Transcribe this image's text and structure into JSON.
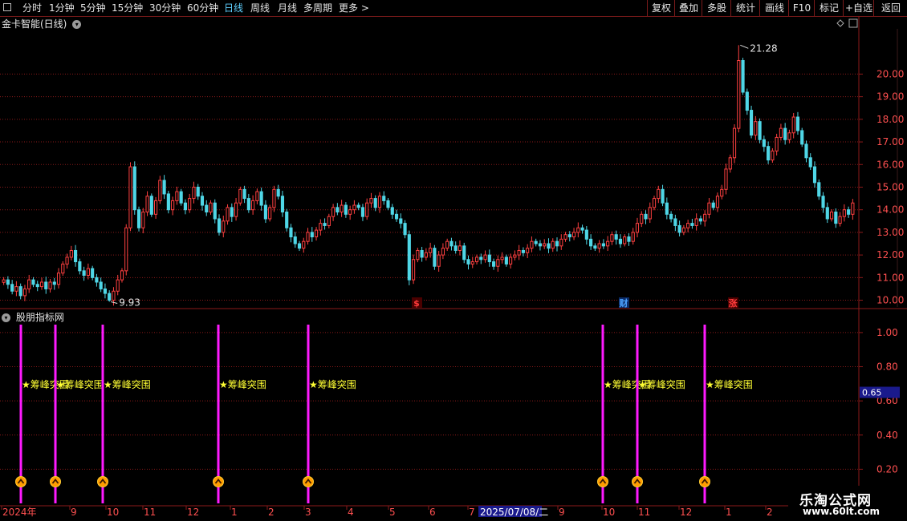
{
  "toolbar": {
    "left_items": [
      "分时",
      "1分钟",
      "5分钟",
      "15分钟",
      "30分钟",
      "60分钟",
      "日线",
      "周线",
      "月线",
      "多周期",
      "更多 >"
    ],
    "active_item": "日线",
    "right_items": [
      "复权",
      "叠加",
      "多股",
      "统计",
      "画线",
      "F10",
      "标记",
      "+自选",
      "返回"
    ]
  },
  "header": {
    "title": "金卡智能(日线)",
    "icon": "chevron-down-circle-icon"
  },
  "indicator": {
    "title": "股朋指标网",
    "current_value": "0.65",
    "signal_label": "★筹峰突围",
    "signals_x": [
      26,
      69,
      128,
      272,
      384,
      751,
      794,
      878
    ],
    "y_ticks": [
      "1.00",
      "0.80",
      "0.60",
      "0.40",
      "0.20"
    ]
  },
  "price_axis": {
    "ticks": [
      "20.00",
      "19.00",
      "18.00",
      "17.00",
      "16.00",
      "15.00",
      "14.00",
      "13.00",
      "12.00",
      "11.00",
      "10.00"
    ]
  },
  "markers": {
    "high_label": "21.28",
    "low_label": "9.93",
    "events": [
      {
        "label": "$",
        "color": "#ff3b3b"
      },
      {
        "label": "财",
        "color": "#4da3ff"
      },
      {
        "label": "涨",
        "color": "#ff3b3b"
      }
    ]
  },
  "time_axis": {
    "labels": [
      "2024年",
      "9",
      "10",
      "11",
      "12",
      "1",
      "2",
      "3",
      "4",
      "5",
      "6",
      "7",
      "2025/07/08/二",
      "9",
      "10",
      "11",
      "12",
      "1",
      "2"
    ]
  },
  "watermark": {
    "line1": "乐淘公式网",
    "line2": "www.60lt.com"
  },
  "colors": {
    "up": "#ff4040",
    "down": "#4fd6e6",
    "grid": "#8b1a1a",
    "signal": "#ff1aff",
    "label": "#ffff33",
    "accent": "#1a1a8c"
  },
  "chart_data": {
    "type": "candlestick",
    "title": "金卡智能(日线)",
    "ylim": [
      9.7,
      22.0
    ],
    "high": 21.28,
    "low": 9.93,
    "series": [
      {
        "name": "close",
        "values": [
          10.9,
          10.7,
          10.4,
          10.6,
          10.2,
          10.5,
          10.9,
          10.7,
          10.6,
          10.8,
          10.5,
          10.8,
          10.7,
          11.2,
          11.6,
          11.9,
          12.2,
          11.7,
          11.3,
          11.1,
          11.4,
          11.0,
          10.8,
          10.5,
          10.3,
          10.0,
          10.4,
          10.9,
          11.3,
          13.2,
          15.9,
          14.0,
          13.2,
          13.9,
          14.6,
          13.8,
          14.4,
          15.3,
          14.7,
          14.0,
          14.4,
          14.8,
          14.3,
          14.0,
          14.5,
          15.0,
          14.6,
          14.2,
          13.9,
          14.3,
          13.6,
          13.0,
          13.5,
          14.1,
          13.7,
          14.3,
          14.9,
          14.5,
          14.0,
          14.4,
          14.8,
          14.2,
          13.6,
          14.1,
          14.9,
          14.6,
          13.9,
          13.2,
          12.8,
          12.5,
          12.3,
          12.6,
          13.0,
          12.8,
          13.1,
          13.4,
          13.3,
          13.7,
          14.1,
          13.9,
          14.2,
          13.8,
          14.0,
          14.2,
          14.1,
          13.7,
          14.3,
          14.5,
          14.1,
          14.6,
          14.4,
          14.1,
          13.8,
          13.6,
          13.4,
          12.9,
          10.9,
          11.8,
          12.2,
          11.9,
          12.1,
          12.3,
          11.5,
          12.0,
          12.3,
          12.6,
          12.4,
          12.2,
          12.4,
          11.8,
          11.6,
          11.7,
          11.9,
          11.8,
          12.0,
          11.7,
          11.5,
          11.8,
          11.9,
          11.6,
          11.9,
          12.0,
          12.2,
          12.1,
          12.3,
          12.6,
          12.5,
          12.4,
          12.5,
          12.3,
          12.6,
          12.4,
          12.7,
          12.9,
          12.8,
          13.0,
          13.2,
          13.1,
          12.7,
          12.4,
          12.3,
          12.5,
          12.4,
          12.6,
          12.9,
          12.7,
          12.5,
          12.8,
          12.6,
          13.0,
          13.4,
          13.8,
          13.6,
          14.1,
          14.5,
          14.9,
          14.3,
          13.8,
          13.6,
          13.3,
          13.0,
          13.2,
          13.4,
          13.3,
          13.6,
          13.5,
          13.8,
          14.3,
          14.1,
          14.6,
          14.9,
          15.8,
          16.3,
          17.6,
          20.6,
          19.2,
          18.4,
          17.3,
          17.9,
          17.1,
          16.8,
          16.2,
          16.6,
          17.2,
          17.6,
          17.1,
          17.4,
          18.1,
          17.5,
          16.9,
          16.3,
          15.9,
          15.2,
          14.6,
          14.1,
          13.6,
          13.9,
          13.4,
          13.7,
          14.0,
          13.8,
          14.3
        ]
      }
    ]
  }
}
